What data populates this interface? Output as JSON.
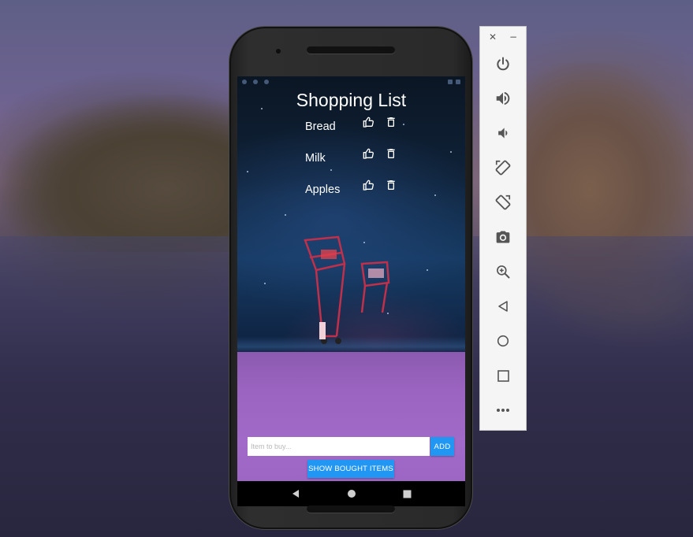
{
  "app": {
    "title": "Shopping List",
    "items": [
      {
        "name": "Bread"
      },
      {
        "name": "Milk"
      },
      {
        "name": "Apples"
      }
    ],
    "input": {
      "placeholder": "Item to buy...",
      "value": ""
    },
    "add_label": "ADD",
    "show_bought_label": "SHOW BOUGHT ITEMS"
  },
  "icons": {
    "like": "thumb-up-icon",
    "delete": "trash-icon"
  },
  "nav": {
    "back": "back-icon",
    "home": "home-icon",
    "recents": "recents-icon"
  },
  "emulator": {
    "close": "✕",
    "minimize": "−",
    "controls": [
      "power-icon",
      "volume-up-icon",
      "volume-down-icon",
      "rotate-left-icon",
      "rotate-right-icon",
      "camera-icon",
      "zoom-in-icon",
      "back-icon",
      "home-icon",
      "overview-icon",
      "more-icon"
    ]
  },
  "colors": {
    "accent": "#2196f3",
    "text": "#ffffff",
    "panel_icon": "#555555"
  }
}
